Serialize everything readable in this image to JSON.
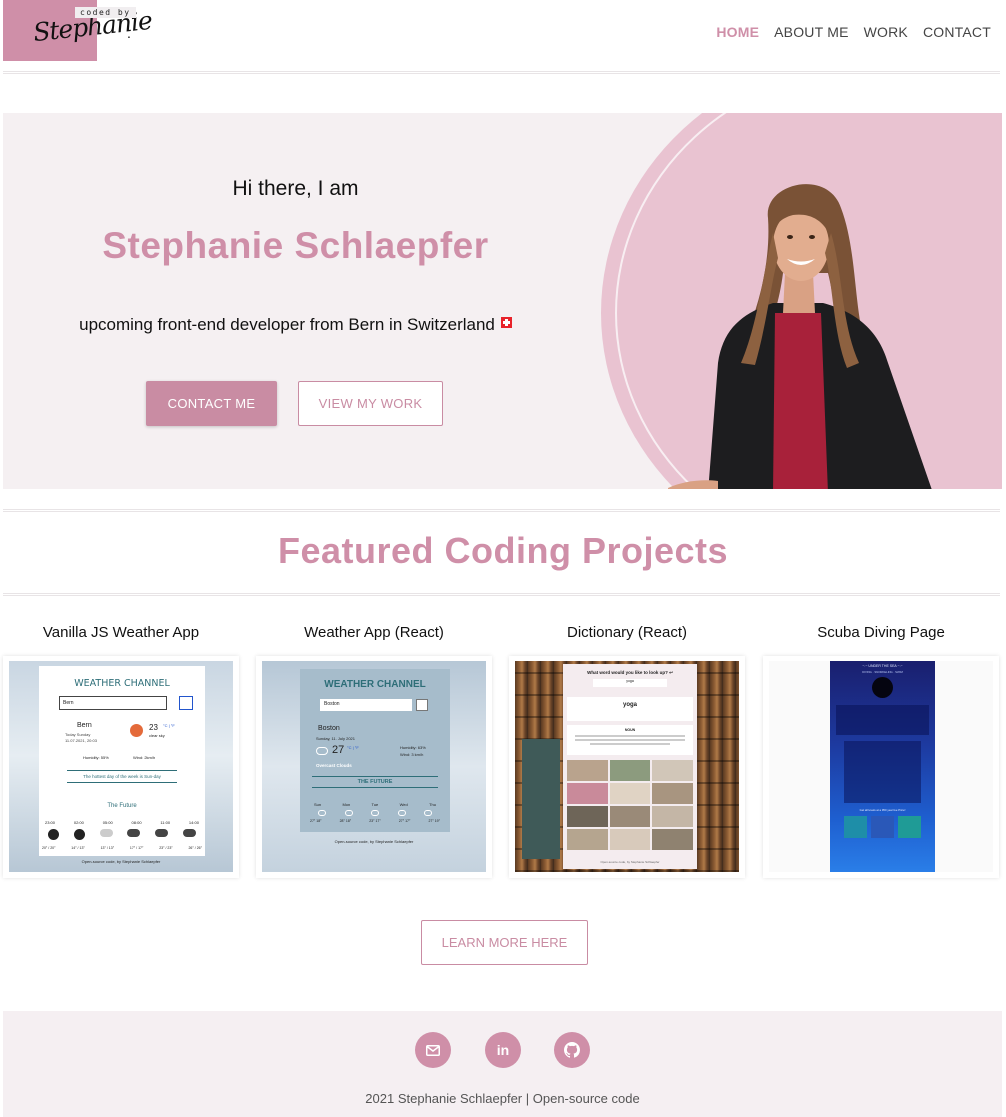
{
  "nav": {
    "logo_tag": "coded by",
    "logo_script": "Stephanie",
    "links": [
      "HOME",
      "ABOUT ME",
      "WORK",
      "CONTACT"
    ]
  },
  "hero": {
    "greeting": "Hi there, I am",
    "name": "Stephanie Schlaepfer",
    "subtitle": "upcoming front-end developer from Bern in Switzerland",
    "contact_button": "CONTACT ME",
    "work_button": "VIEW MY WORK"
  },
  "projects": {
    "title": "Featured Coding Projects",
    "items": [
      {
        "title": "Vanilla JS Weather App",
        "app_title": "WEATHER CHANNEL",
        "search_value": "Bern",
        "city": "Bern",
        "date_line1": "Today Sunday",
        "date_line2": "11.07.2021, 20:03",
        "temp": "23",
        "units": "°C | °F",
        "condition": "clear sky",
        "humidity": "Humidity: 55%",
        "wind": "Wind: 2km/h",
        "message": "The hottest day of the week is Sun-day",
        "future_label": "The Future",
        "hours": [
          "23:00",
          "02:00",
          "05:00",
          "08:00",
          "11:00",
          "14:00"
        ],
        "temps": [
          "20° / 20°",
          "14° / 13°",
          "13° / 13°",
          "17° / 17°",
          "23° / 23°",
          "26° / 26°"
        ],
        "footer": "Open-source code, by Stephanie Schlaepfer"
      },
      {
        "title": "Weather App (React)",
        "app_title": "WEATHER CHANNEL",
        "search_value": "Boston",
        "city": "Boston",
        "date": "Sunday, 11. July 2021",
        "temp": "27",
        "units": "°C | °F",
        "humidity": "Humidity: 63%",
        "wind": "Wind: 3 km/h",
        "condition": "Overcast Clouds",
        "future_label": "THE FUTURE",
        "days": [
          "Sun",
          "Mon",
          "Tue",
          "Wed",
          "Thu"
        ],
        "day_temps": [
          "27° 18°",
          "28° 18°",
          "23° 17°",
          "27° 17°",
          "27° 19°"
        ],
        "footer": "Open-source code, by Stephanie Schlaepfer"
      },
      {
        "title": "Dictionary (React)",
        "question": "What word would you like to look up? ↩",
        "search_value": "yoga",
        "word": "yoga",
        "section": "NOUN",
        "footer": "Open-source code, by Stephanie Schlaepfer"
      },
      {
        "title": "Scuba Diving Page",
        "header": "~.~ UNDER THE SEA ~.~",
        "sub": "DIVING · SNORKELING · SWIM",
        "price_line": "Get all levels at a 950 year fee Price!"
      }
    ],
    "learn_more": "LEARN MORE HERE"
  },
  "footer": {
    "text": "2021 Stephanie Schlaepfer | Open-source code"
  },
  "colors": {
    "accent": "#cf8fa8",
    "hero_bg": "#f5f0f2",
    "blob": "#e9c3d1",
    "footer_bg": "#f5eff2"
  }
}
